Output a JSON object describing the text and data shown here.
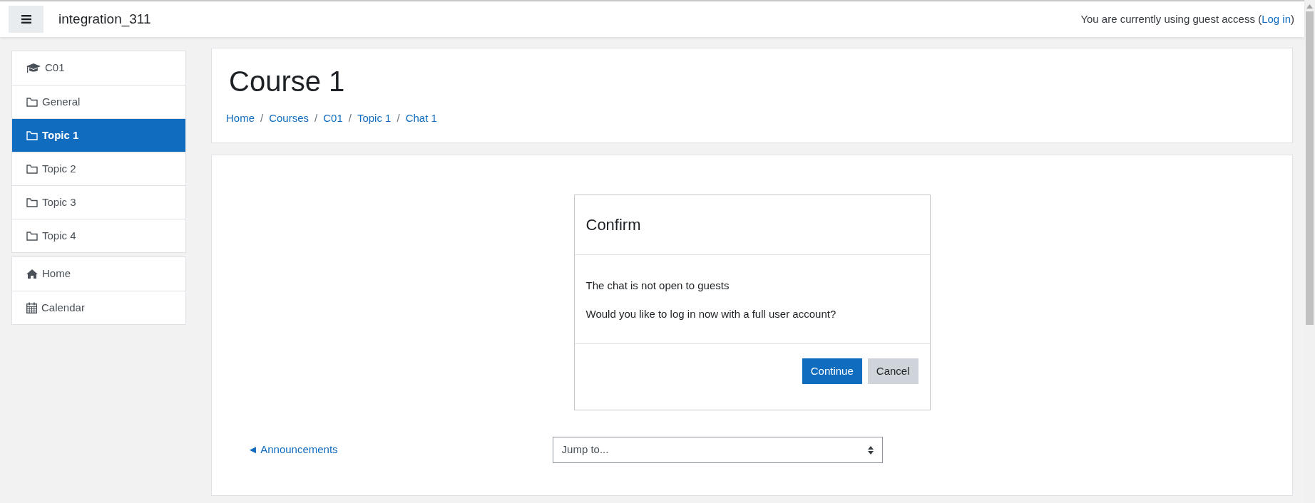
{
  "header": {
    "site_name": "integration_311",
    "guest_notice": {
      "text_before": "You are currently using guest access (",
      "link": "Log in",
      "text_after": ")"
    }
  },
  "sidebar": {
    "groups": [
      {
        "items": [
          {
            "kind": "course",
            "label": "C01",
            "selected": false
          },
          {
            "kind": "folder",
            "label": "General",
            "selected": false
          },
          {
            "kind": "folder",
            "label": "Topic 1",
            "selected": true
          },
          {
            "kind": "folder",
            "label": "Topic 2",
            "selected": false
          },
          {
            "kind": "folder",
            "label": "Topic 3",
            "selected": false
          },
          {
            "kind": "folder",
            "label": "Topic 4",
            "selected": false
          }
        ]
      },
      {
        "items": [
          {
            "kind": "home",
            "label": "Home",
            "selected": false
          },
          {
            "kind": "calendar",
            "label": "Calendar",
            "selected": false
          }
        ]
      }
    ]
  },
  "page_header": {
    "title": "Course 1",
    "breadcrumb": [
      {
        "label": "Home",
        "separator_after": "/"
      },
      {
        "label": "Courses",
        "separator_after": "/"
      },
      {
        "label": "C01",
        "separator_after": "/"
      },
      {
        "label": "Topic 1",
        "separator_after": "/"
      },
      {
        "label": "Chat 1"
      }
    ]
  },
  "dialog": {
    "title": "Confirm",
    "messages": [
      "The chat is not open to guests",
      "Would you like to log in now with a full user account?"
    ],
    "buttons": [
      {
        "label": "Continue",
        "kind": "primary"
      },
      {
        "label": "Cancel",
        "kind": "secondary"
      }
    ]
  },
  "activity_nav": {
    "previous_link": "◄ Announcements",
    "jump_select": {
      "value": "Jump to..."
    }
  }
}
